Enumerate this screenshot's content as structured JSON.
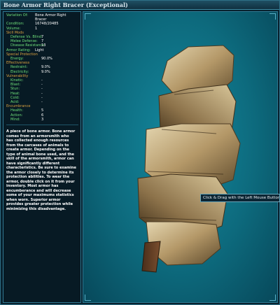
{
  "window": {
    "title": "Bone Armor Right Bracer (Exceptional)"
  },
  "stats": {
    "variation_key": "Variation Of:",
    "variation_val": "Bone Armor Right",
    "variation_val2": "Bracer",
    "condition_key": "Condition:",
    "condition_val": "16748/20485",
    "volume_key": "Volume:",
    "volume_val": "1",
    "skill_mods": "Skill Mods",
    "defense_blind_key": "Defense Vs. Blind:",
    "defense_blind_val": "7",
    "melee_defense_key": "Melee Defense:",
    "melee_defense_val": "7",
    "disease_res_key": "Disease Resistance:",
    "disease_res_val": "13",
    "armor_rating_key": "Armor Rating:",
    "armor_rating_val": "Light",
    "special_protection": "Special Protection",
    "energy_key": "Energy:",
    "energy_val": "90.0%",
    "effectiveness": "Effectiveness",
    "restraint_key": "Restraint:",
    "restraint_val": "9.0%",
    "electricity_key": "Electricity:",
    "electricity_val": "9.0%",
    "vulnerability": "Vulnerability",
    "kinetic_key": "Kinetic:",
    "kinetic_val": "-",
    "blast_key": "Blast:",
    "blast_val": "-",
    "stun_key": "Stun:",
    "stun_val": "-",
    "heat_key": "Heat:",
    "heat_val": "-",
    "cold_key": "Cold:",
    "cold_val": "-",
    "acid_key": "Acid:",
    "acid_val": "-",
    "encumbrance": "Encumbrance",
    "health_key": "Health:",
    "health_val": "5",
    "action_key": "Action:",
    "action_val": "6",
    "mind_key": "Mind:",
    "mind_val": "3"
  },
  "description": "A piece of bone armor. Bone armor comes from an armorsmith who has collected enough resources from the carcases of animals to create armor. Depending on the type of animal bone used, and the skill of the armorsmith, armor can have significantly different characteristics. Be sure to examine the armor closely to determine its protection abilities. To wear the armor, double click on it from your inventory. Most armor has encumberance and will decrease some of your maximums statistics when worn. Superior armor provides greater protection while minimizing this disadvantage.",
  "viewer": {
    "tooltip": "Click & Drag with the Left Mouse Button to"
  }
}
